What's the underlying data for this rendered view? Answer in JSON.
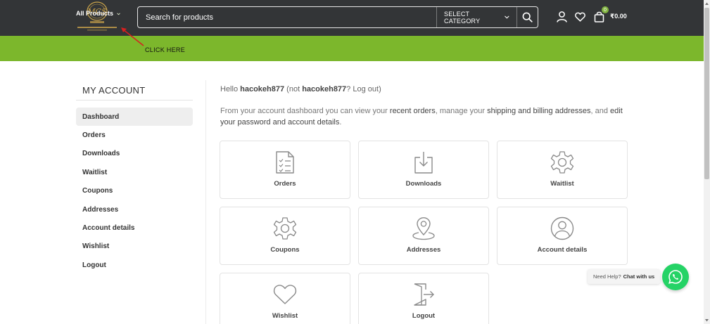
{
  "header": {
    "search_placeholder": "Search for products",
    "category_label": "SELECT CATEGORY",
    "cart_count": "0",
    "cart_total": "₹0.00"
  },
  "nav": {
    "all_products": "All Products",
    "annotation": "CLICK HERE"
  },
  "sidebar": {
    "title": "MY ACCOUNT",
    "items": [
      {
        "label": "Dashboard",
        "active": true
      },
      {
        "label": "Orders"
      },
      {
        "label": "Downloads"
      },
      {
        "label": "Waitlist"
      },
      {
        "label": "Coupons"
      },
      {
        "label": "Addresses"
      },
      {
        "label": "Account details"
      },
      {
        "label": "Wishlist"
      },
      {
        "label": "Logout"
      }
    ]
  },
  "content": {
    "hello_prefix": "Hello ",
    "username": "hacokeh877",
    "hello_mid": " (not ",
    "username2": "hacokeh877",
    "hello_q": "? ",
    "logout_link": "Log out",
    "hello_end": ")",
    "desc_1": "From your account dashboard you can view your ",
    "desc_link1": "recent orders",
    "desc_2": ", manage your ",
    "desc_link2": "shipping and billing addresses",
    "desc_3": ", and ",
    "desc_link3": "edit your password and account details",
    "desc_4": ".",
    "cards": [
      {
        "label": "Orders",
        "icon": "orders-icon"
      },
      {
        "label": "Downloads",
        "icon": "download-icon"
      },
      {
        "label": "Waitlist",
        "icon": "gear-icon"
      },
      {
        "label": "Coupons",
        "icon": "gear-icon"
      },
      {
        "label": "Addresses",
        "icon": "location-pin-icon"
      },
      {
        "label": "Account details",
        "icon": "user-circle-icon"
      },
      {
        "label": "Wishlist",
        "icon": "heart-icon"
      },
      {
        "label": "Logout",
        "icon": "logout-door-icon"
      }
    ]
  },
  "whatsapp": {
    "need_help": "Need Help?",
    "chat": "Chat with us"
  },
  "colors": {
    "header_bg": "#333537",
    "nav_green": "#7cb72c",
    "whatsapp": "#25d366",
    "logo_gold": "#c9a34a"
  }
}
